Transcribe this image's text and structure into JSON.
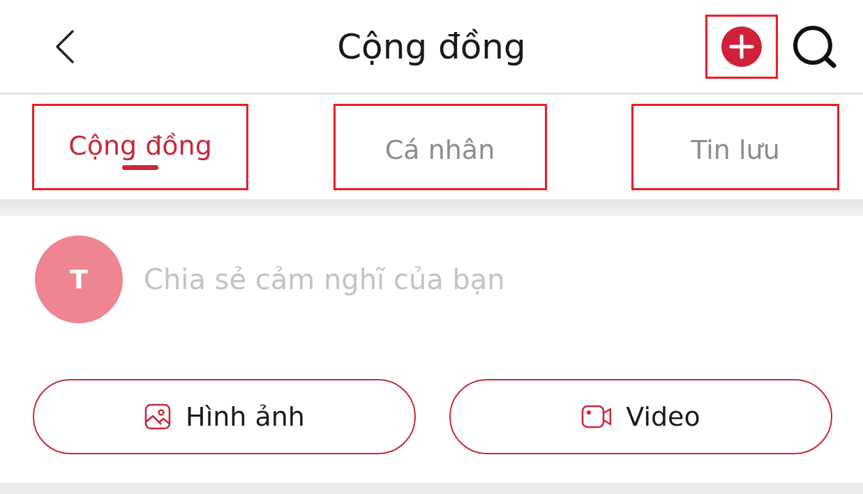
{
  "header": {
    "title": "Cộng đồng",
    "add_button": {
      "highlighted": true
    }
  },
  "tabs": [
    {
      "label": "Cộng đồng",
      "selected": true,
      "highlighted": true
    },
    {
      "label": "Cá nhân",
      "selected": false,
      "highlighted": true
    },
    {
      "label": "Tin lưu",
      "selected": false,
      "highlighted": true
    }
  ],
  "composer": {
    "avatar": "T",
    "placeholder": "Chia sẻ cảm nghĩ của bạn"
  },
  "buttons": [
    {
      "kind": "image",
      "label": "Hình ảnh"
    },
    {
      "kind": "video",
      "label": "Video"
    }
  ]
}
